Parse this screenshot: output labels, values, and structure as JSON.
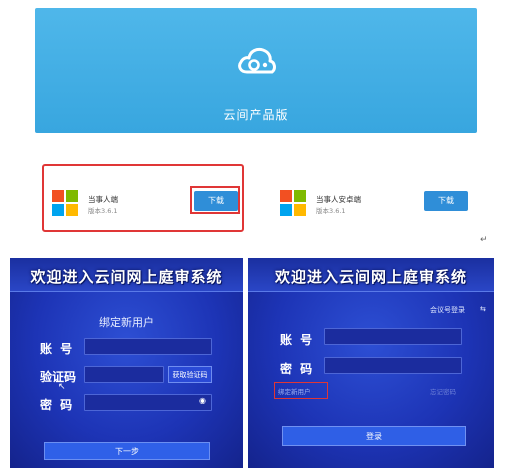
{
  "banner": {
    "title": "云间产品版",
    "background": "#3ea9e0"
  },
  "downloads": [
    {
      "name": "当事人端",
      "version": "版本3.6.1",
      "button": "下载",
      "highlighted": true
    },
    {
      "name": "当事人安卓端",
      "version": "版本3.6.1",
      "button": "下载",
      "highlighted": false
    }
  ],
  "bind_panel": {
    "title": "欢迎进入云间网上庭审系统",
    "subtitle": "绑定新用户",
    "account_label": "账 号",
    "code_label": "验证码",
    "password_label": "密 码",
    "get_code_button": "获取验证码",
    "next_button": "下一步"
  },
  "login_panel": {
    "title": "欢迎进入云间网上庭审系统",
    "meeting_login_link": "会议号登录",
    "account_label": "账 号",
    "password_label": "密 码",
    "bind_link": "绑定新用户",
    "forgot_link": "忘记密码",
    "login_button": "登录"
  },
  "colors": {
    "highlight": "#e03636",
    "download_button": "#2f8ed8",
    "panel_blue": "#1d34b6"
  },
  "icons": [
    "cloud-logo-icon",
    "windows-icon",
    "eye-icon",
    "return-arrow-icon",
    "mouse-cursor-icon"
  ]
}
